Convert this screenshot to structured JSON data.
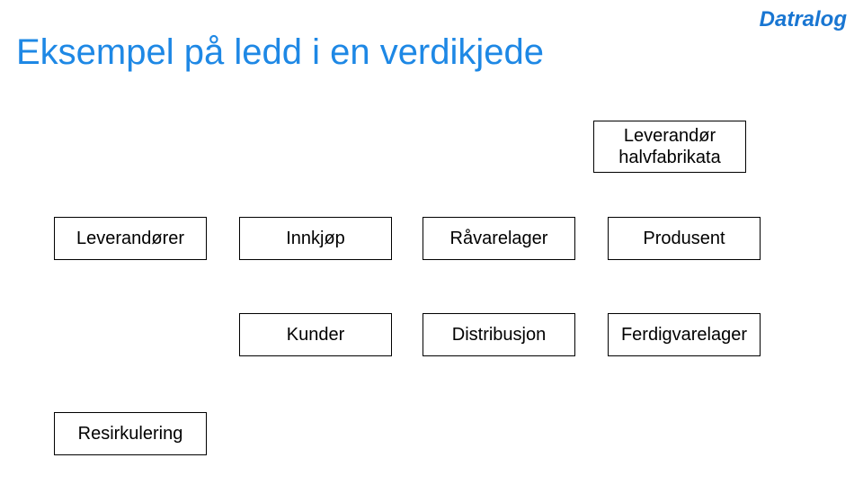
{
  "brand": "Datralog",
  "title": "Eksempel på ledd i en verdikjede",
  "boxes": {
    "leverandor_halvfabrikata": "Leverandør\nhalvfabrikata",
    "leverandorer": "Leverandører",
    "innkjop": "Innkjøp",
    "ravarelager": "Råvarelager",
    "produsent": "Produsent",
    "kunder": "Kunder",
    "distribusjon": "Distribusjon",
    "ferdigvarelager": "Ferdigvarelager",
    "resirkulering": "Resirkulering"
  }
}
